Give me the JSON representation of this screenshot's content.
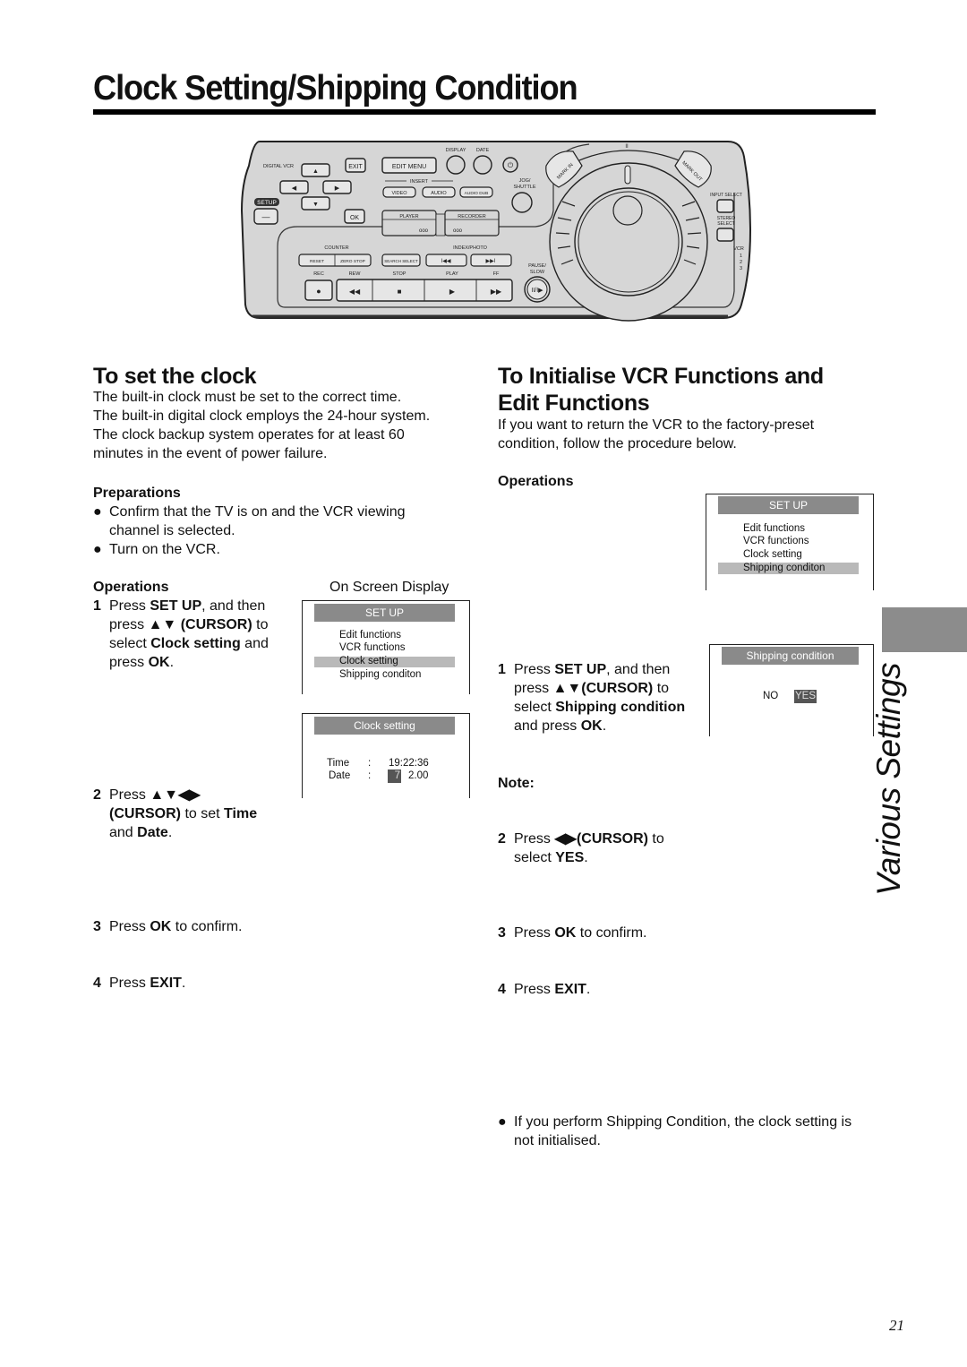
{
  "page": {
    "title": "Clock Setting/Shipping Condition",
    "page_number": "21",
    "side_section_label": "Various Settings",
    "colors": {
      "osd_header": "#8a8a8a",
      "osd_highlight": "#b9b9b9",
      "remote_body": "#d6d6d6",
      "side_tab": "#8c8c8c"
    }
  },
  "remote": {
    "brand": "DIGITAL VCR",
    "labels": {
      "exit": "EXIT",
      "edit_menu": "EDIT MENU",
      "display": "DISPLAY",
      "date": "DATE",
      "insert": "INSERT",
      "video": "VIDEO",
      "audio": "AUDIO",
      "audio_dub": "AUDIO DUB",
      "jog_shuttle_1": "JOG/",
      "jog_shuttle_2": "SHUTTLE",
      "setup": "SETUP",
      "ok": "OK",
      "player": "PLAYER",
      "recorder": "RECORDER",
      "counter": "COUNTER",
      "index_photo": "INDEX/PHOTO",
      "reset": "RESET",
      "zero_stop": "ZERO STOP",
      "search_select": "SEARCH SELECT",
      "rec": "REC",
      "rew": "REW",
      "stop": "STOP",
      "play": "PLAY",
      "ff": "FF",
      "pause_slow_1": "PAUSE/",
      "pause_slow_2": "SLOW",
      "mark_in": "MARK IN",
      "mark_out": "MARK OUT",
      "input_select": "INPUT SELECT",
      "stereo_select_1": "STEREO",
      "stereo_select_2": "SELECT",
      "vcr": "VCR",
      "vcr_1": "1",
      "vcr_2": "2",
      "vcr_3": "3",
      "player_dots": "ooo",
      "recorder_dots": "ooo"
    },
    "icons": {
      "up": "▲",
      "down": "▼",
      "left": "◀",
      "right": "▶",
      "minus": "—",
      "rec": "●",
      "rew": "◀◀",
      "stop": "■",
      "play": "▶",
      "ff": "▶▶",
      "prev": "I◀◀",
      "next": "▶▶I",
      "pause_slow": "II/I▶",
      "pause": "II"
    }
  },
  "clock_section": {
    "heading": "To set the clock",
    "intro": [
      "The built-in clock must be set to the correct time.",
      "The built-in digital clock employs the 24-hour system.",
      "The clock backup system operates for at least 60",
      "minutes in the event of power failure."
    ],
    "preparations_heading": "Preparations",
    "preparations": [
      {
        "line1": "Confirm that the TV is on and the VCR viewing",
        "line2": "channel is selected."
      },
      {
        "line1": "Turn on the VCR."
      }
    ],
    "operations_heading": "Operations",
    "osd_caption": "On Screen Display",
    "steps": [
      {
        "num": "1",
        "parts": [
          "Press ",
          "SET UP",
          ", and then",
          "press ",
          "▲▼ (CURSOR)",
          " to",
          "select ",
          "Clock setting",
          " and",
          "press ",
          "OK",
          "."
        ]
      },
      {
        "num": "2",
        "parts": [
          "Press ",
          "▲▼◀▶",
          "(CURSOR)",
          " to set ",
          "Time",
          "and ",
          "Date",
          "."
        ]
      },
      {
        "num": "3",
        "parts": [
          "Press ",
          "OK",
          " to confirm."
        ]
      },
      {
        "num": "4",
        "parts": [
          "Press ",
          "EXIT",
          "."
        ]
      }
    ],
    "osd_setup": {
      "header": "SET UP",
      "items": [
        "Edit functions",
        "VCR functions",
        "Clock setting",
        "Shipping conditon"
      ],
      "selected_index": 2
    },
    "osd_clock": {
      "header": "Clock setting",
      "time_label": "Time",
      "time_sep": ":",
      "time_value": "19:22:36",
      "date_label": "Date",
      "date_sep": ":",
      "date_cursor": "7",
      "date_value": "2.00"
    }
  },
  "shipping_section": {
    "heading_line1": "To Initialise VCR Functions and",
    "heading_line2": "Edit Functions",
    "intro": [
      "If you want to return the VCR to the factory-preset",
      "condition, follow the procedure below."
    ],
    "operations_heading": "Operations",
    "steps": [
      {
        "num": "1",
        "parts": [
          "Press ",
          "SET UP",
          ", and then",
          "press ",
          "▲▼(CURSOR)",
          " to",
          "select ",
          "Shipping condition",
          "and press ",
          "OK",
          "."
        ]
      },
      {
        "num": "2",
        "parts": [
          "Press ",
          "◀▶(CURSOR)",
          " to",
          "select ",
          "YES",
          "."
        ]
      },
      {
        "num": "3",
        "parts": [
          "Press ",
          "OK",
          " to confirm."
        ]
      },
      {
        "num": "4",
        "parts": [
          "Press ",
          "EXIT",
          "."
        ]
      }
    ],
    "osd_setup": {
      "header": "SET UP",
      "items": [
        "Edit functions",
        "VCR functions",
        "Clock setting",
        "Shipping conditon"
      ],
      "selected_index": 3
    },
    "osd_shipping": {
      "header": "Shipping condition",
      "option_no": "NO",
      "option_yes": "YES",
      "selected": "YES"
    },
    "note_heading": "Note:",
    "note": {
      "line1": "If you perform Shipping Condition, the clock setting is",
      "line2": "not initialised."
    }
  },
  "bullet_glyph": "●"
}
